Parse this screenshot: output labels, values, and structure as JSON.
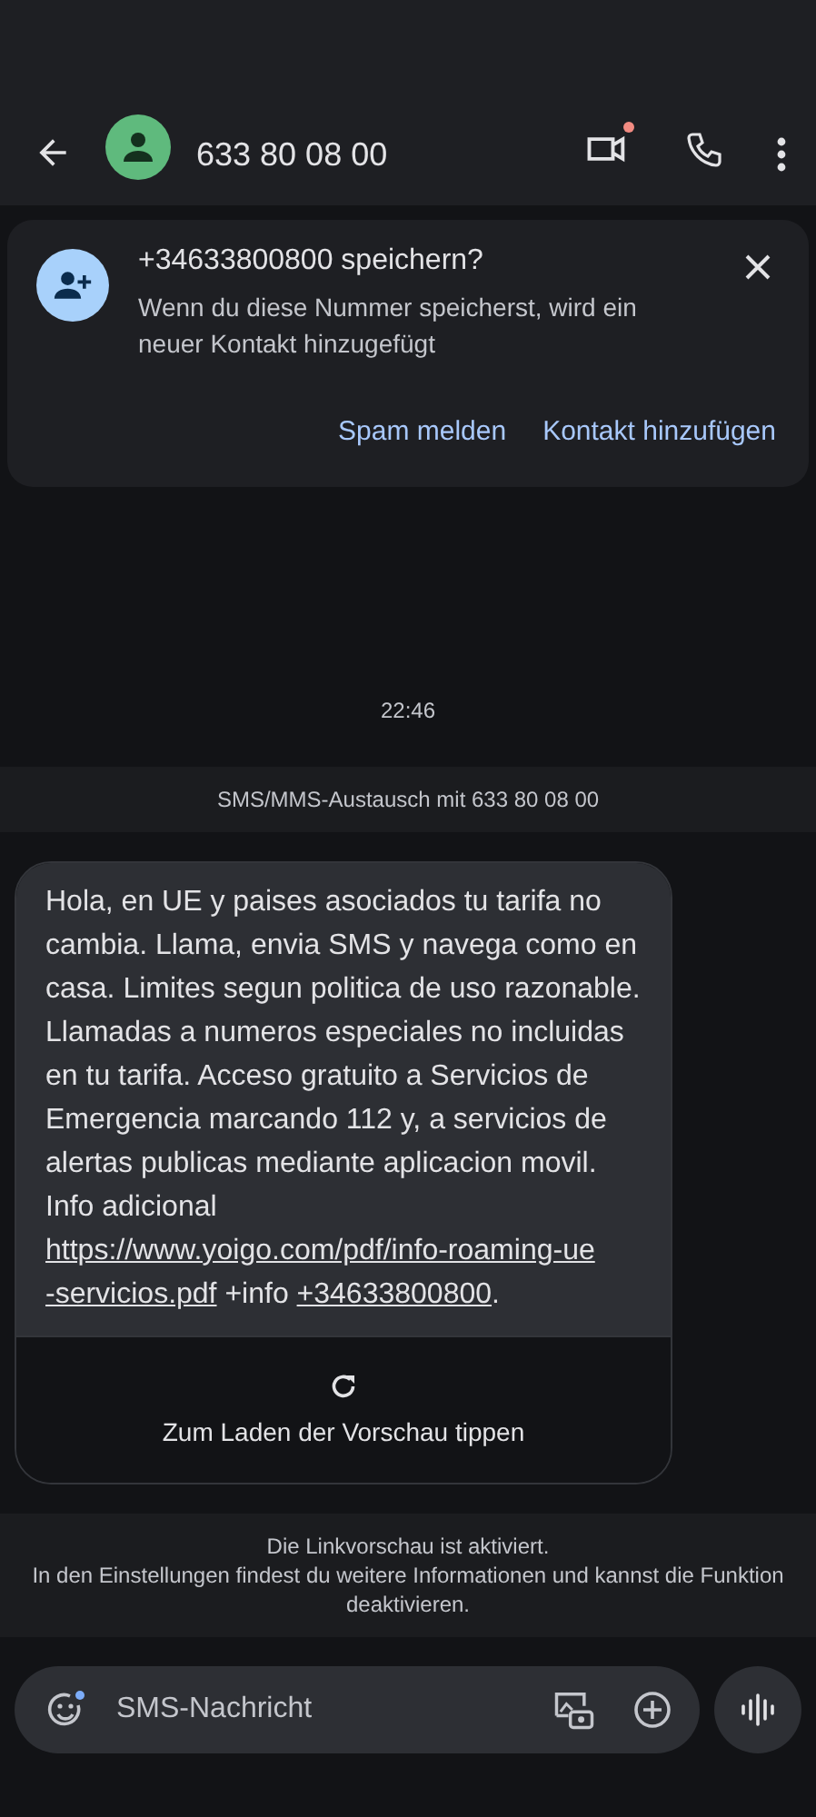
{
  "header": {
    "title": "633 80 08 00",
    "video_badge": true
  },
  "save_card": {
    "title": "+34633800800 speichern?",
    "text": "Wenn du diese Nummer speicherst, wird ein neuer Kontakt hinzugefügt",
    "actions": [
      "Spam melden",
      "Kontakt hinzufügen"
    ]
  },
  "timestamp": "22:46",
  "exchange_notice": "SMS/MMS-Austausch mit 633 80 08 00",
  "message": {
    "segments": [
      {
        "kind": "text",
        "text": "Hola, en UE y paises asociados tu tarifa no cambia. Llama, envia SMS y navega como en casa. Limites segun politica de uso razonable. Llamadas a numeros especiales no incluidas en tu tarifa. Acceso gratuito a Servicios de Emergencia marcando 112 y, a servicios de alertas publicas mediante aplicacion movil. Info adicional "
      },
      {
        "kind": "link",
        "text": "https://www.yoigo.com/pdf/info-roaming-ue"
      },
      {
        "kind": "break"
      },
      {
        "kind": "link",
        "text": "-servicios.pdf"
      },
      {
        "kind": "text",
        "text": " +info "
      },
      {
        "kind": "link",
        "text": "+34633800800"
      },
      {
        "kind": "text",
        "text": "."
      }
    ],
    "preview_label": "Zum Laden der Vorschau tippen"
  },
  "link_preview_notice": [
    "Die Linkvorschau ist aktiviert.",
    "In den Einstellungen findest du weitere Informationen und kannst die Funktion deaktivieren."
  ],
  "compose": {
    "placeholder": "SMS-Nachricht",
    "emoji_badge": true
  }
}
